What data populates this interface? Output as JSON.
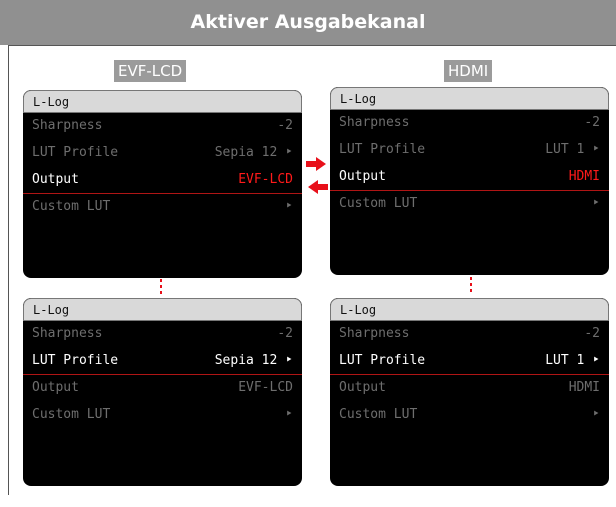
{
  "header": {
    "title": "Aktiver Ausgabekanal"
  },
  "channels": {
    "left": "EVF-LCD",
    "right": "HDMI"
  },
  "colors": {
    "accent_red": "#ff1a1a",
    "header_bg": "#909090",
    "menu_bg": "#000000"
  },
  "icons": {
    "arrow_right": "arrow-right-icon",
    "arrow_left": "arrow-left-icon",
    "submenu": "chevron-right-icon"
  },
  "panels": [
    {
      "title": "L-Log",
      "rows": [
        {
          "label": "Sharpness",
          "value": "-2"
        },
        {
          "label": "LUT Profile",
          "value": "Sepia 12 ‣"
        },
        {
          "label": "Output",
          "value": "EVF-LCD"
        },
        {
          "label": "Custom LUT",
          "value": "‣"
        }
      ]
    },
    {
      "title": "L-Log",
      "rows": [
        {
          "label": "Sharpness",
          "value": "-2"
        },
        {
          "label": "LUT Profile",
          "value": "LUT 1 ‣"
        },
        {
          "label": "Output",
          "value": "HDMI"
        },
        {
          "label": "Custom LUT",
          "value": "‣"
        }
      ]
    },
    {
      "title": "L-Log",
      "rows": [
        {
          "label": "Sharpness",
          "value": "-2"
        },
        {
          "label": "LUT Profile",
          "value": "Sepia 12 ‣"
        },
        {
          "label": "Output",
          "value": "EVF-LCD"
        },
        {
          "label": "Custom LUT",
          "value": "‣"
        }
      ]
    },
    {
      "title": "L-Log",
      "rows": [
        {
          "label": "Sharpness",
          "value": "-2"
        },
        {
          "label": "LUT Profile",
          "value": "LUT 1 ‣"
        },
        {
          "label": "Output",
          "value": "HDMI"
        },
        {
          "label": "Custom LUT",
          "value": "‣"
        }
      ]
    }
  ]
}
